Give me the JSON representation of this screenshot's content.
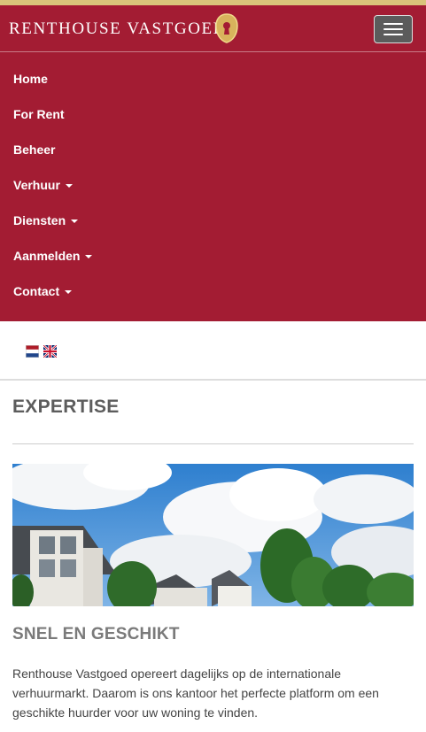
{
  "header": {
    "brand": "RENTHOUSE VASTGOED",
    "menu_toggle": "menu-toggle"
  },
  "nav": {
    "items": [
      {
        "label": "Home",
        "dropdown": false
      },
      {
        "label": "For Rent",
        "dropdown": false
      },
      {
        "label": "Beheer",
        "dropdown": false
      },
      {
        "label": "Verhuur",
        "dropdown": true
      },
      {
        "label": "Diensten",
        "dropdown": true
      },
      {
        "label": "Aanmelden",
        "dropdown": true
      },
      {
        "label": "Contact",
        "dropdown": true
      }
    ]
  },
  "languages": [
    "nl-flag-icon",
    "uk-flag-icon"
  ],
  "main": {
    "title": "EXPERTISE",
    "subtitle": "SNEL EN GESCHIKT",
    "body": "Renthouse Vastgoed opereert dagelijks op de internationale verhuurmarkt. Daarom is ons kantoor  het perfecte platform om een geschikte huurder voor uw woning te vinden."
  },
  "colors": {
    "brand_red": "#a31c33",
    "gold": "#d9c47a",
    "heading_grey": "#5c5c5c"
  }
}
